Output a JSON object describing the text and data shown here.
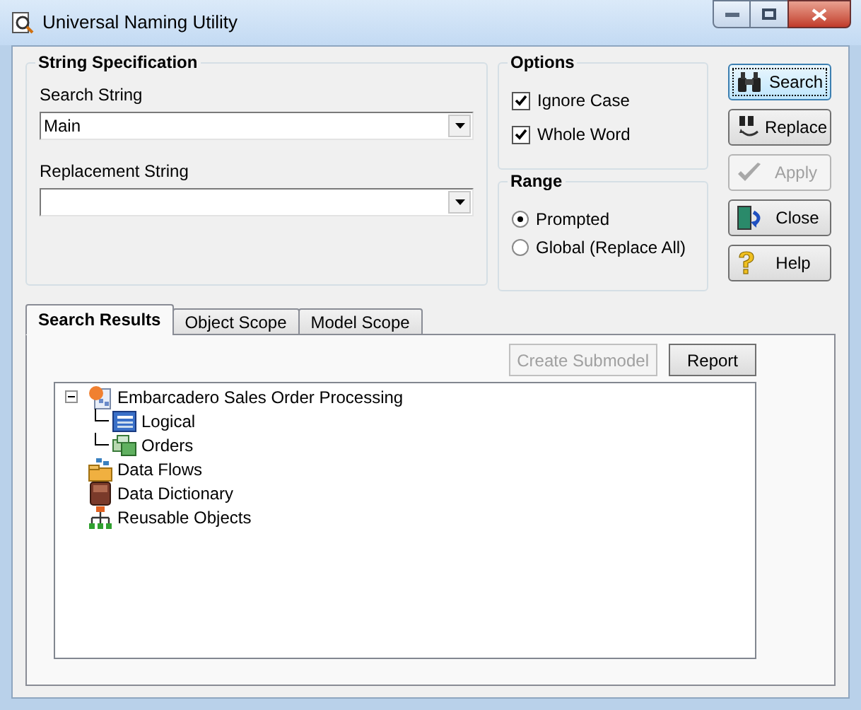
{
  "window": {
    "title": "Universal Naming Utility"
  },
  "string_specification": {
    "title": "String Specification",
    "search_string": {
      "label": "Search String",
      "value": "Main"
    },
    "replacement_string": {
      "label": "Replacement String"
    }
  },
  "options": {
    "title": "Options",
    "items": [
      {
        "label": "Ignore Case",
        "checked": true
      },
      {
        "label": "Whole Word",
        "checked": true
      }
    ]
  },
  "range": {
    "title": "Range",
    "items": [
      {
        "label": "Prompted",
        "selected": true
      },
      {
        "label": "Global (Replace All)",
        "selected": false
      }
    ]
  },
  "buttons": [
    {
      "kind": "search",
      "label": "Search",
      "disabled": false,
      "focused": true
    },
    {
      "kind": "replace",
      "label": "Replace",
      "disabled": false,
      "focused": false
    },
    {
      "kind": "apply",
      "label": "Apply",
      "disabled": true,
      "focused": false
    },
    {
      "kind": "close",
      "label": "Close",
      "disabled": false,
      "focused": false
    },
    {
      "kind": "help",
      "label": "Help",
      "disabled": false,
      "focused": false
    }
  ],
  "tabs": [
    {
      "label": "Search Results",
      "selected": true
    },
    {
      "label": "Object Scope",
      "selected": false
    },
    {
      "label": "Model Scope",
      "selected": false
    }
  ],
  "results_buttons": [
    {
      "label": "Create Submodel",
      "disabled": true
    },
    {
      "label": "Report",
      "disabled": false
    }
  ],
  "tree": [
    {
      "kind": "model",
      "label": "Embarcadero Sales Order Processing",
      "expanded": true,
      "children": [
        {
          "kind": "logical",
          "label": "Logical"
        },
        {
          "kind": "submodel",
          "label": "Orders"
        }
      ]
    },
    {
      "kind": "dataflows",
      "label": "Data Flows"
    },
    {
      "kind": "dictionary",
      "label": "Data Dictionary"
    },
    {
      "kind": "reusable",
      "label": "Reusable Objects"
    }
  ]
}
